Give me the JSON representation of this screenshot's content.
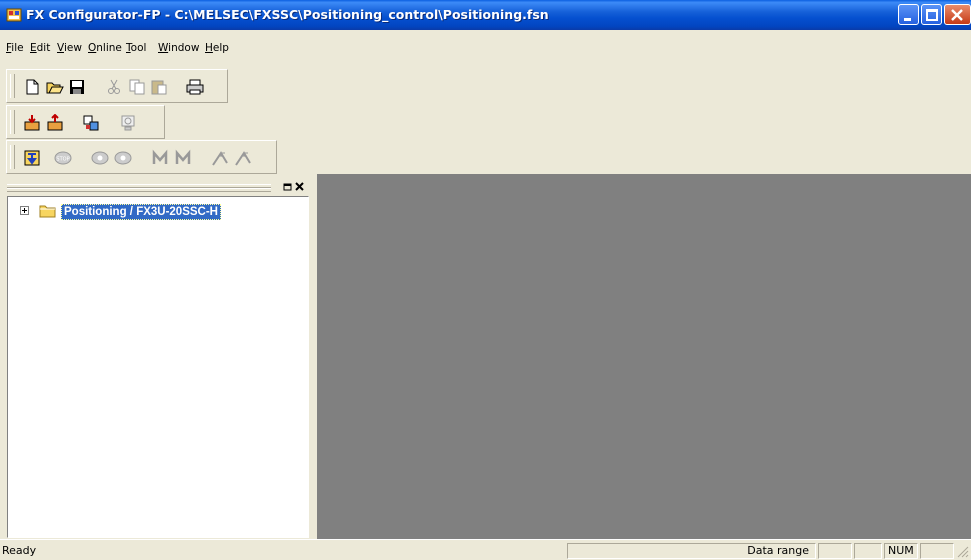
{
  "window": {
    "title": "FX Configurator-FP - C:\\MELSEC\\FXSSC\\Positioning_control\\Positioning.fsn"
  },
  "menu": [
    {
      "label": "File",
      "accel": "F"
    },
    {
      "label": "Edit",
      "accel": "E"
    },
    {
      "label": "View",
      "accel": "V"
    },
    {
      "label": "Online",
      "accel": "O"
    },
    {
      "label": "Tool",
      "accel": "T"
    },
    {
      "label": "Window",
      "accel": "W"
    },
    {
      "label": "Help",
      "accel": "H"
    }
  ],
  "toolbar_standard": [
    "new-file-icon",
    "open-folder-icon",
    "save-icon",
    "cut-icon",
    "copy-icon",
    "paste-icon",
    "print-icon"
  ],
  "toolbar_online": [
    "read-from-plc-icon",
    "write-to-plc-icon",
    "verify-icon",
    "monitor-icon"
  ],
  "toolbar_test": [
    "test-icon",
    "stop-icon",
    "jog-forward-icon",
    "jog-reverse-icon",
    "manual-pulse-icon",
    "manual-pulse-2-icon",
    "zero-return-icon",
    "zero-return-2-icon"
  ],
  "tree": {
    "root_label": "Positioning / FX3U-20SSC-H",
    "expander": "+"
  },
  "statusbar": {
    "ready": "Ready",
    "data_range": "Data range",
    "num": "NUM"
  },
  "colors": {
    "title_bar": "#0550D0",
    "selection": "#316AC5",
    "mdi_background": "#808080",
    "chrome": "#ECE9D8"
  }
}
